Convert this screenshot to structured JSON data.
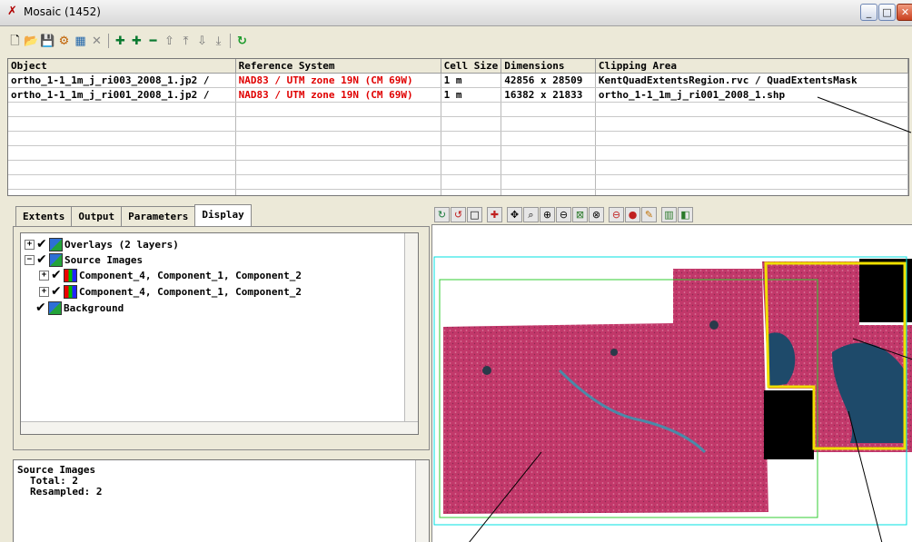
{
  "window": {
    "title": "Mosaic (1452)"
  },
  "toolbar": {
    "icons": [
      "new-icon",
      "open-icon",
      "save-icon",
      "run-icon",
      "add-icon",
      "delete-icon",
      "plus-icon",
      "plus-icon",
      "minus-icon",
      "layer-up-icon",
      "layer-up-icon",
      "layer-down-icon",
      "layer-down-icon",
      "refresh-icon"
    ]
  },
  "table": {
    "headers": [
      "Object",
      "Reference System",
      "Cell Size",
      "Dimensions",
      "Clipping Area"
    ],
    "rows": [
      [
        "ortho_1-1_1m_j_ri003_2008_1.jp2 /",
        "NAD83 / UTM zone 19N (CM 69W)",
        "1 m",
        "42856 x 28509",
        "KentQuadExtentsRegion.rvc / QuadExtentsMask"
      ],
      [
        "ortho_1-1_1m_j_ri001_2008_1.jp2 /",
        "NAD83 / UTM zone 19N (CM 69W)",
        "1 m",
        "16382 x 21833",
        "ortho_1-1_1m_j_ri001_2008_1.shp"
      ]
    ],
    "reference_color": "#e00000"
  },
  "tabs": [
    "Extents",
    "Output",
    "Parameters",
    "Display"
  ],
  "active_tab": "Display",
  "tree": {
    "overlays": "Overlays  (2 layers)",
    "source_images": "Source Images",
    "component_a": "Component_4, Component_1, Component_2",
    "component_b": "Component_4, Component_1, Component_2",
    "background": "Background"
  },
  "info": {
    "line1": "Source Images",
    "line2": "Total: 2",
    "line3": "Resampled: 2"
  },
  "colors": {
    "extent_outline": "#00ffff",
    "clip_outline": "#f0e000",
    "mask_outline": "#33cc33",
    "image_tint": "#c2386a"
  }
}
